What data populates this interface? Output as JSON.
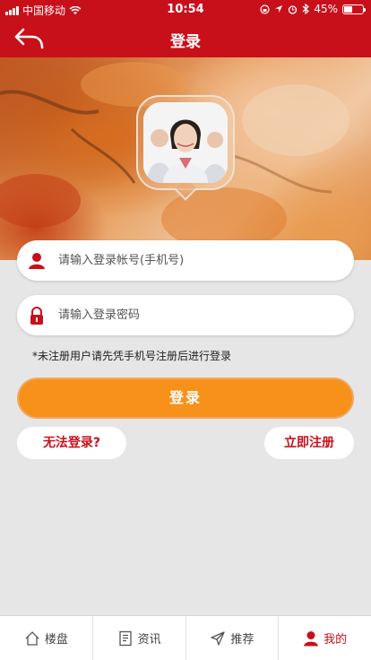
{
  "status_bar": {
    "carrier": "中国移动",
    "time": "10:54",
    "battery": "45%",
    "battery_level": 0.45
  },
  "nav": {
    "title": "登录",
    "back_icon": "back-arrow-icon"
  },
  "form": {
    "account_placeholder": "请输入登录帐号(手机号)",
    "password_placeholder": "请输入登录密码",
    "notice": "*未注册用户请先凭手机号注册后进行登录",
    "login_label": "登录",
    "cannot_login_label": "无法登录?",
    "register_label": "立即注册"
  },
  "tabs": [
    {
      "label": "楼盘",
      "icon": "home-icon"
    },
    {
      "label": "资讯",
      "icon": "news-icon"
    },
    {
      "label": "推荐",
      "icon": "send-icon"
    },
    {
      "label": "我的",
      "icon": "user-icon",
      "active": true
    }
  ],
  "colors": {
    "brand_red": "#c8101b",
    "accent_orange": "#f7911a",
    "background": "#e6e6e6"
  }
}
